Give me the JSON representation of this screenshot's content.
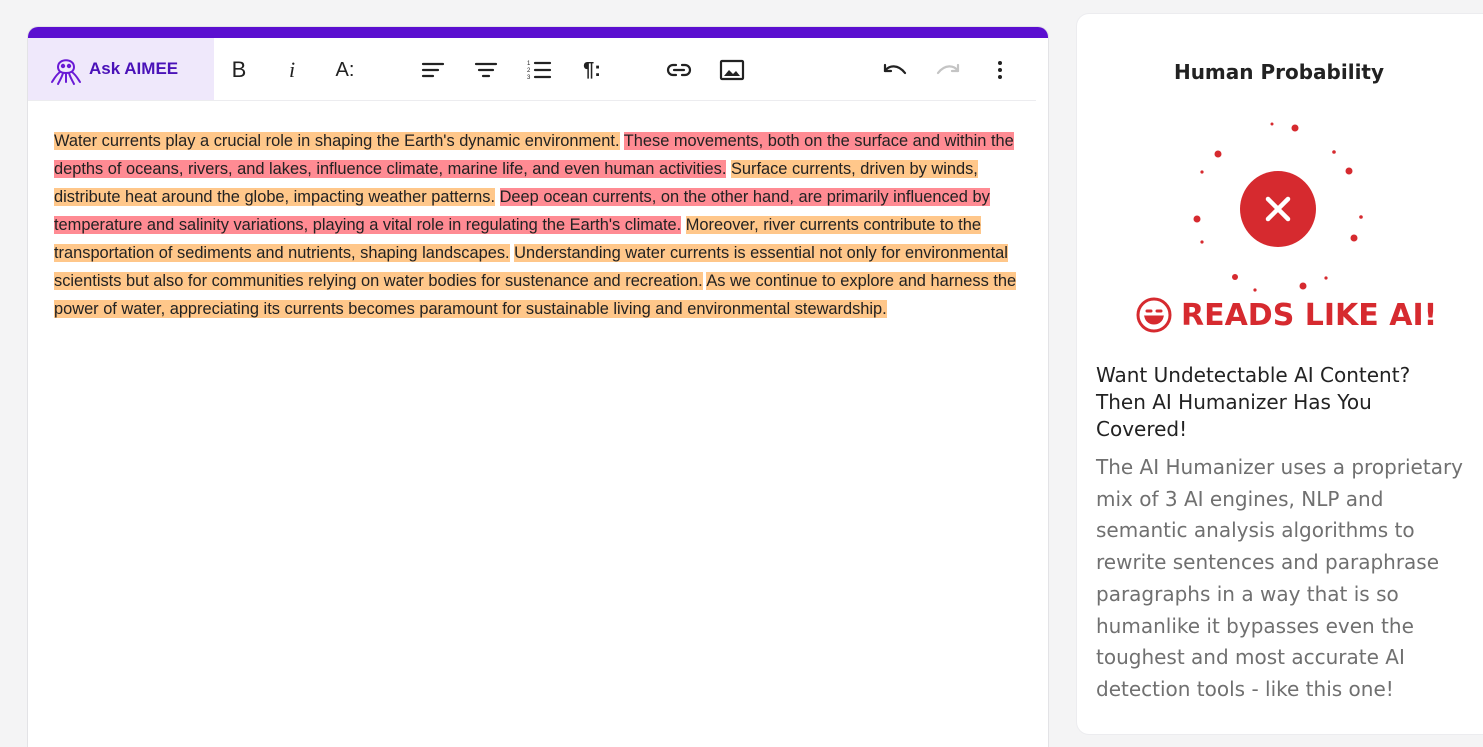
{
  "toolbar": {
    "ask_label": "Ask AIMEE",
    "bold_label": "B",
    "italic_label": "i",
    "font_size_label": "A:",
    "paragraph_label": "¶:"
  },
  "content": {
    "segments": [
      {
        "text": "Water currents play a crucial role in shaping the Earth's dynamic environment.",
        "level": "orange"
      },
      {
        "text": "These movements, both on the surface and within the depths of oceans, rivers, and lakes, influence climate, marine life, and even human activities.",
        "level": "red"
      },
      {
        "text": "Surface currents, driven by winds, distribute heat around the globe, impacting weather patterns.",
        "level": "orange"
      },
      {
        "text": "Deep ocean currents, on the other hand, are primarily influenced by temperature and salinity variations, playing a vital role in regulating the Earth's climate.",
        "level": "red"
      },
      {
        "text": "Moreover, river currents contribute to the transportation of sediments and nutrients, shaping landscapes.",
        "level": "orange"
      },
      {
        "text": "Understanding water currents is essential not only for environmental scientists but also for communities relying on water bodies for sustenance and recreation.",
        "level": "orange"
      },
      {
        "text": "As we continue to explore and harness the power of water, appreciating its currents becomes paramount for sustainable living and environmental stewardship.",
        "level": "orange"
      }
    ]
  },
  "panel": {
    "title": "Human Probability",
    "verdict": "READS LIKE AI!",
    "promo_heading": "Want Undetectable AI Content? Then AI Humanizer Has You Covered!",
    "promo_body": "The AI Humanizer uses a proprietary mix of 3 AI engines, NLP and semantic analysis algorithms to rewrite sentences and paraphrase paragraphs in a way that is so humanlike it bypasses even the toughest and most accurate AI detection tools - like this one!"
  },
  "colors": {
    "accent": "#5b0fd0",
    "highlight_orange": "#ffc78a",
    "highlight_red": "#ff8b93",
    "verdict_red": "#d62a2f"
  },
  "icons": [
    "octopus-icon",
    "bold-icon",
    "italic-icon",
    "font-size-icon",
    "align-left-icon",
    "align-center-icon",
    "numbered-list-icon",
    "paragraph-icon",
    "link-icon",
    "image-icon",
    "undo-icon",
    "redo-icon",
    "more-vertical-icon",
    "close-x-icon",
    "smiley-icon"
  ]
}
